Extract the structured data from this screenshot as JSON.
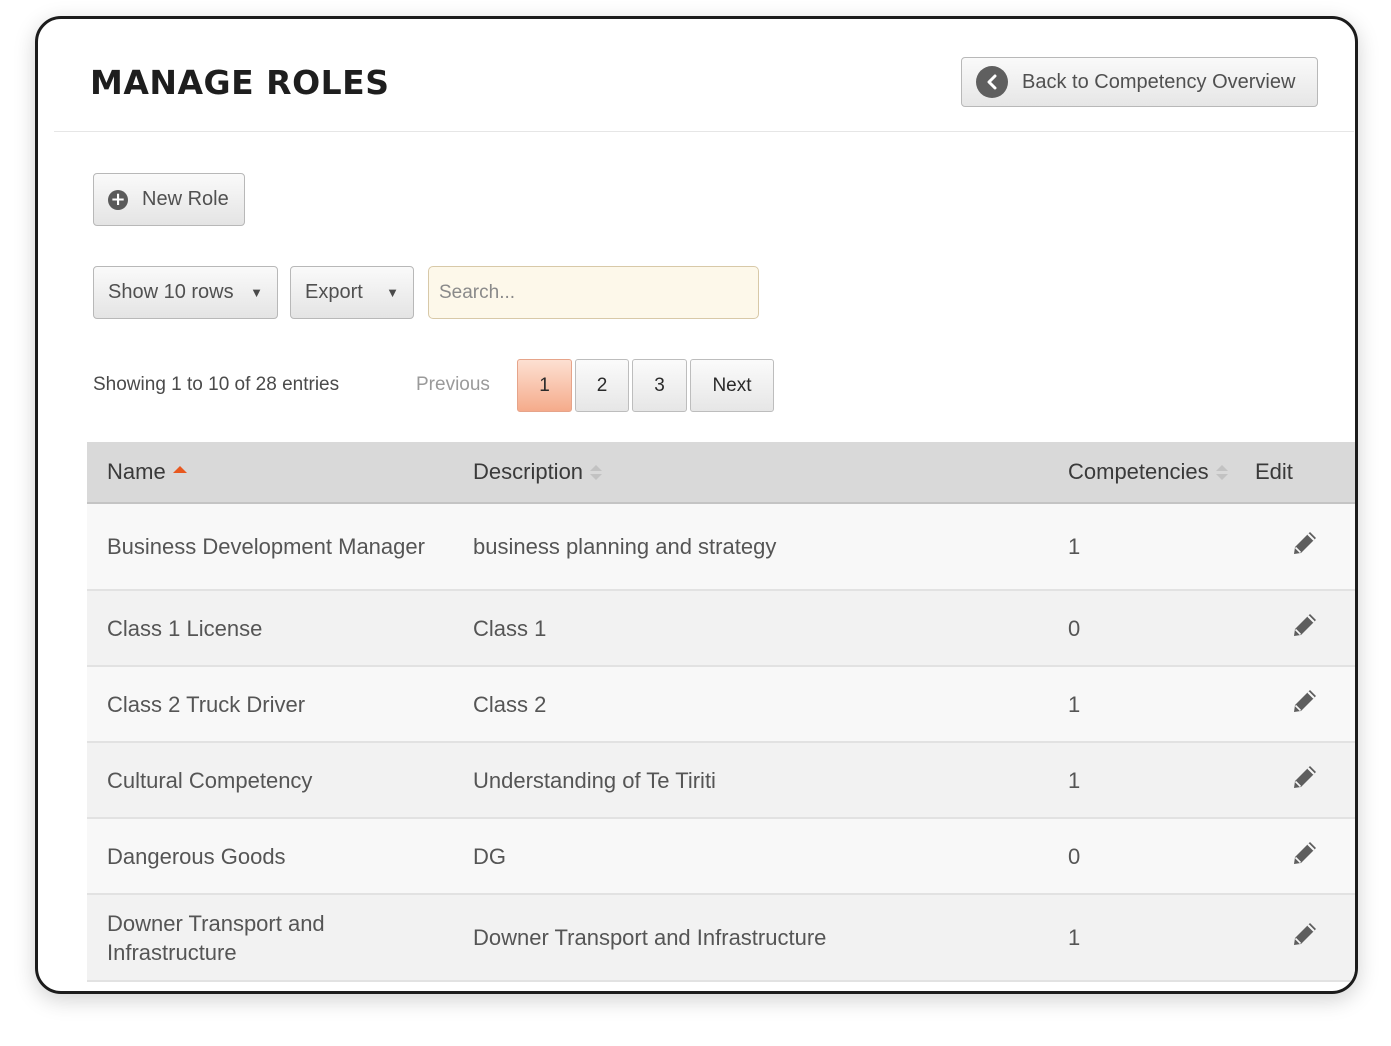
{
  "header": {
    "title": "MANAGE ROLES",
    "back_label": "Back to Competency Overview"
  },
  "toolbar": {
    "new_role_label": "New Role",
    "show_rows_label": "Show 10 rows",
    "export_label": "Export",
    "search_placeholder": "Search..."
  },
  "pagination": {
    "info": "Showing 1 to 10 of 28 entries",
    "previous_label": "Previous",
    "pages": [
      "1",
      "2",
      "3"
    ],
    "active_page": "1",
    "next_label": "Next"
  },
  "table": {
    "columns": {
      "name": "Name",
      "description": "Description",
      "competencies": "Competencies",
      "edit": "Edit"
    },
    "sorted_column": "name",
    "sort_direction": "ascending",
    "rows": [
      {
        "name": "Business Development Manager",
        "description": "business planning and strategy",
        "competencies": "1"
      },
      {
        "name": "Class 1 License",
        "description": "Class 1",
        "competencies": "0"
      },
      {
        "name": "Class 2 Truck Driver",
        "description": "Class 2",
        "competencies": "1"
      },
      {
        "name": "Cultural Competency",
        "description": "Understanding of Te Tiriti",
        "competencies": "1"
      },
      {
        "name": "Dangerous Goods",
        "description": "DG",
        "competencies": "0"
      },
      {
        "name": "Downer Transport and Infrastructure",
        "description": "Downer Transport and Infrastructure",
        "competencies": "1"
      }
    ]
  },
  "colors": {
    "active_page": "#f5ab8b",
    "sort_indicator": "#e8581f",
    "search_bg": "#fdf8ea",
    "header_bg": "#d9d9d9"
  },
  "icons": {
    "back": "chevron-left-icon",
    "new": "plus-circle-icon",
    "edit": "pencil-icon"
  }
}
